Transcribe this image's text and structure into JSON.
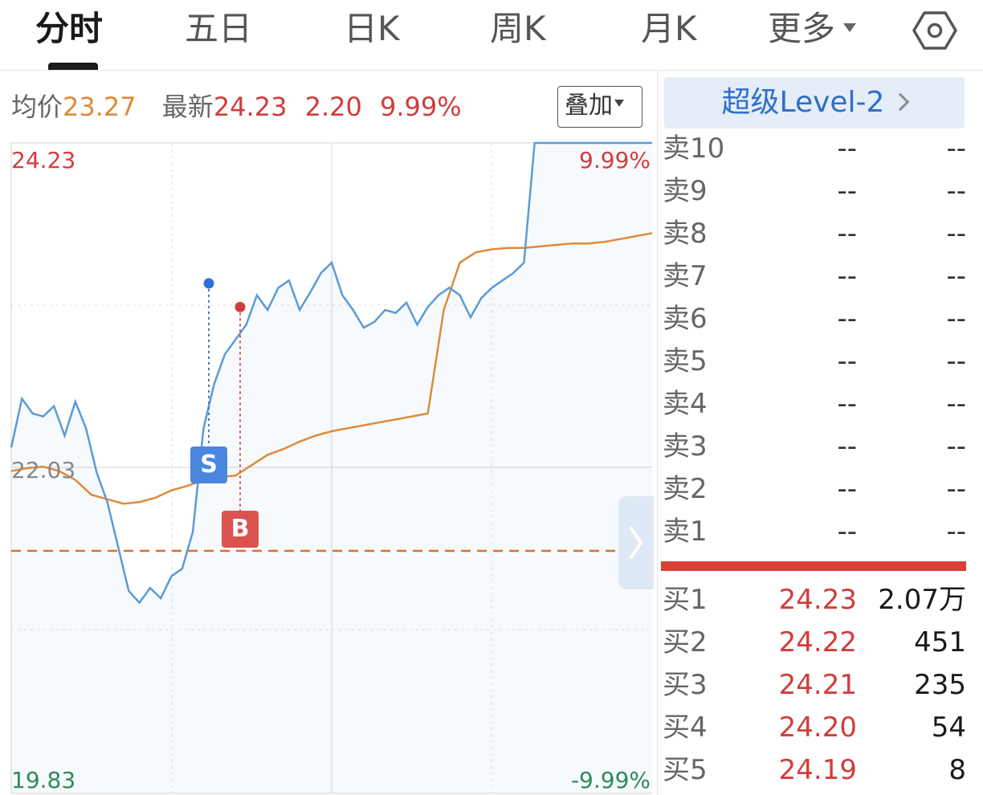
{
  "tabs": [
    {
      "label": "分时",
      "active": true
    },
    {
      "label": "五日",
      "active": false
    },
    {
      "label": "日K",
      "active": false
    },
    {
      "label": "周K",
      "active": false
    },
    {
      "label": "月K",
      "active": false
    },
    {
      "label": "更多",
      "active": false
    }
  ],
  "info": {
    "avg_label": "均价",
    "avg_value": "23.27",
    "latest_label": "最新",
    "latest_price": "24.23",
    "change": "2.20",
    "change_pct": "9.99%",
    "overlay_label": "叠加"
  },
  "chart": {
    "price_high": "24.23",
    "price_mid": "22.03",
    "price_low": "19.83",
    "pct_high": "9.99%",
    "pct_low": "-9.99%",
    "marker_sell": "S",
    "marker_buy": "B",
    "colors": {
      "price_line": "#5b9bd5",
      "avg_line": "#e08a3a",
      "ref_dash": "#d9702a",
      "up": "#d23c3c",
      "down": "#2e8b57"
    }
  },
  "chart_data": {
    "type": "line",
    "ylim": [
      19.83,
      24.23
    ],
    "reference_price": 22.03,
    "series": [
      {
        "name": "price",
        "values": [
          22.17,
          22.5,
          22.4,
          22.38,
          22.45,
          22.25,
          22.48,
          22.3,
          22.0,
          21.8,
          21.5,
          21.2,
          21.12,
          21.22,
          21.15,
          21.3,
          21.35,
          21.6,
          22.3,
          22.6,
          22.8,
          22.9,
          23.0,
          23.2,
          23.1,
          23.25,
          23.3,
          23.1,
          23.22,
          23.35,
          23.42,
          23.2,
          23.1,
          22.98,
          23.02,
          23.1,
          23.08,
          23.15,
          23.0,
          23.12,
          23.2,
          23.25,
          23.2,
          23.05,
          23.18,
          23.25,
          23.3,
          23.35,
          23.42,
          24.23,
          24.23,
          24.23,
          24.23,
          24.23,
          24.23,
          24.23,
          24.23,
          24.23,
          24.23,
          24.23,
          24.23
        ]
      },
      {
        "name": "avg",
        "values": [
          22.01,
          22.03,
          22.04,
          22.01,
          21.95,
          21.85,
          21.82,
          21.79,
          21.8,
          21.83,
          21.88,
          21.91,
          21.95,
          21.97,
          21.98,
          22.05,
          22.12,
          22.16,
          22.21,
          22.25,
          22.28,
          22.3,
          22.32,
          22.34,
          22.36,
          22.38,
          22.4,
          23.1,
          23.42,
          23.49,
          23.51,
          23.52,
          23.52,
          23.53,
          23.54,
          23.55,
          23.55,
          23.56,
          23.58,
          23.6,
          23.62
        ]
      }
    ],
    "annotations": [
      {
        "label": "S",
        "price": 23.28
      },
      {
        "label": "B",
        "price": 23.12
      }
    ]
  },
  "panel": {
    "level2_label": "超级Level-2",
    "sell": [
      {
        "name": "卖10",
        "price": "--",
        "vol": "--"
      },
      {
        "name": "卖9",
        "price": "--",
        "vol": "--"
      },
      {
        "name": "卖8",
        "price": "--",
        "vol": "--"
      },
      {
        "name": "卖7",
        "price": "--",
        "vol": "--"
      },
      {
        "name": "卖6",
        "price": "--",
        "vol": "--"
      },
      {
        "name": "卖5",
        "price": "--",
        "vol": "--"
      },
      {
        "name": "卖4",
        "price": "--",
        "vol": "--"
      },
      {
        "name": "卖3",
        "price": "--",
        "vol": "--"
      },
      {
        "name": "卖2",
        "price": "--",
        "vol": "--"
      },
      {
        "name": "卖1",
        "price": "--",
        "vol": "--"
      }
    ],
    "buy": [
      {
        "name": "买1",
        "price": "24.23",
        "vol": "2.07万"
      },
      {
        "name": "买2",
        "price": "24.22",
        "vol": "451"
      },
      {
        "name": "买3",
        "price": "24.21",
        "vol": "235"
      },
      {
        "name": "买4",
        "price": "24.20",
        "vol": "54"
      },
      {
        "name": "买5",
        "price": "24.19",
        "vol": "8"
      }
    ]
  }
}
